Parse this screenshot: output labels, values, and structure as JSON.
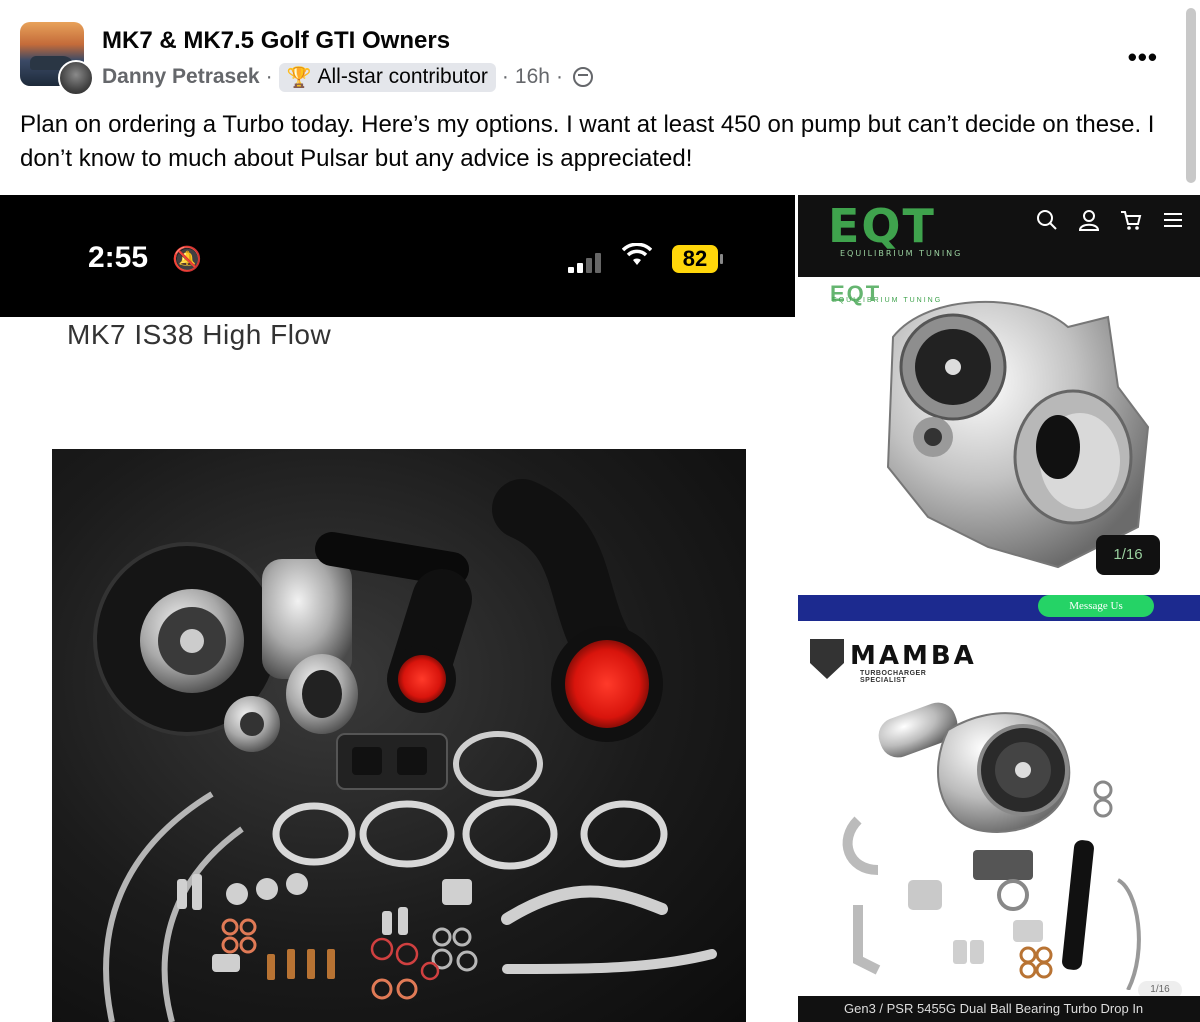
{
  "post": {
    "group_name": "MK7 & MK7.5 Golf GTI Owners",
    "author": "Danny Petrasek",
    "badge": "All-star contributor",
    "time": "16h",
    "separator": "·",
    "more_label": "•••",
    "body": "Plan on ordering a Turbo today. Here’s my options. I want at least 450 on pump but can’t decide on these. I don’t know to much about Pulsar but any advice is appreciated!"
  },
  "left_image": {
    "status_time": "2:55",
    "battery": "82",
    "product_title": "MK7 IS38 High Flow"
  },
  "right_top_image": {
    "logo": "EQT",
    "logo_sub": "EQUILIBRIUM TUNING",
    "counter": "1/16"
  },
  "right_bottom_image": {
    "logo": "MAMBA",
    "logo_sub": "TURBOCHARGER SPECIALIST",
    "message_button": "Message Us",
    "caption": "Gen3 / PSR 5455G Dual Ball Bearing Turbo Drop In",
    "pager": "1/16"
  },
  "icons": {
    "trophy": "trophy-icon",
    "globe": "globe-icon",
    "bell_mute": "bell-slash-icon",
    "wifi": "wifi-icon",
    "search": "search-icon",
    "user": "user-icon",
    "cart": "cart-icon",
    "menu": "menu-icon"
  },
  "colors": {
    "eqt_green": "#3fa34d",
    "mamba_blue": "#1c2a8f",
    "whatsapp_green": "#25d366",
    "battery_yellow": "#ffd60a"
  }
}
